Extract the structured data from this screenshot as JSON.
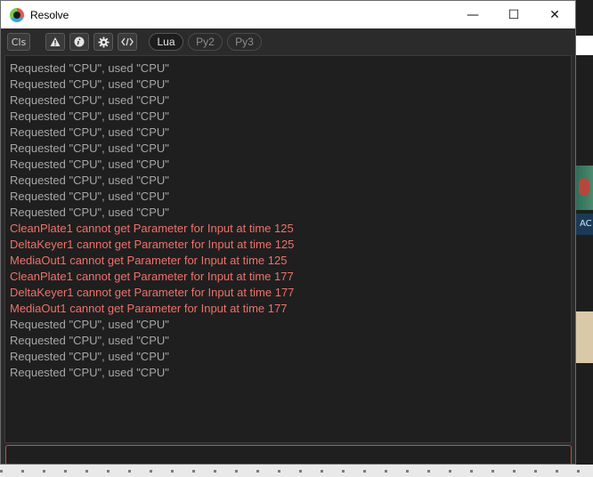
{
  "window": {
    "title": "Resolve",
    "controls": {
      "minimize": "—",
      "maximize": "☐",
      "close": "✕"
    }
  },
  "toolbar": {
    "clear_label": "Cls",
    "icons": [
      {
        "name": "warning-icon",
        "glyph": "⚠"
      },
      {
        "name": "info-icon",
        "glyph": "i"
      },
      {
        "name": "gear-icon",
        "glyph": "⚙"
      },
      {
        "name": "code-icon",
        "glyph": "</>"
      }
    ],
    "languages": [
      {
        "label": "Lua",
        "active": true
      },
      {
        "label": "Py2",
        "active": false
      },
      {
        "label": "Py3",
        "active": false
      }
    ]
  },
  "console": {
    "lines": [
      {
        "text": "Requested \"CPU\", used \"CPU\"",
        "level": "info"
      },
      {
        "text": "Requested \"CPU\", used \"CPU\"",
        "level": "info"
      },
      {
        "text": "Requested \"CPU\", used \"CPU\"",
        "level": "info"
      },
      {
        "text": "Requested \"CPU\", used \"CPU\"",
        "level": "info"
      },
      {
        "text": "Requested \"CPU\", used \"CPU\"",
        "level": "info"
      },
      {
        "text": "Requested \"CPU\", used \"CPU\"",
        "level": "info"
      },
      {
        "text": "Requested \"CPU\", used \"CPU\"",
        "level": "info"
      },
      {
        "text": "Requested \"CPU\", used \"CPU\"",
        "level": "info"
      },
      {
        "text": "Requested \"CPU\", used \"CPU\"",
        "level": "info"
      },
      {
        "text": "Requested \"CPU\", used \"CPU\"",
        "level": "info"
      },
      {
        "text": "CleanPlate1 cannot get Parameter for Input at time 125",
        "level": "error"
      },
      {
        "text": "DeltaKeyer1 cannot get Parameter for Input at time 125",
        "level": "error"
      },
      {
        "text": "MediaOut1 cannot get Parameter for Input at time 125",
        "level": "error"
      },
      {
        "text": "CleanPlate1 cannot get Parameter for Input at time 177",
        "level": "error"
      },
      {
        "text": "DeltaKeyer1 cannot get Parameter for Input at time 177",
        "level": "error"
      },
      {
        "text": "MediaOut1 cannot get Parameter for Input at time 177",
        "level": "error"
      },
      {
        "text": "Requested \"CPU\", used \"CPU\"",
        "level": "info"
      },
      {
        "text": "Requested \"CPU\", used \"CPU\"",
        "level": "info"
      },
      {
        "text": "Requested \"CPU\", used \"CPU\"",
        "level": "info"
      },
      {
        "text": "Requested \"CPU\", used \"CPU\"",
        "level": "info"
      }
    ],
    "input_value": ""
  },
  "background": {
    "side_label": "AC"
  },
  "colors": {
    "info_text": "#a6a6a6",
    "error_text": "#f0706a",
    "input_border": "#d04b40",
    "console_bg": "#1f1f1f"
  }
}
